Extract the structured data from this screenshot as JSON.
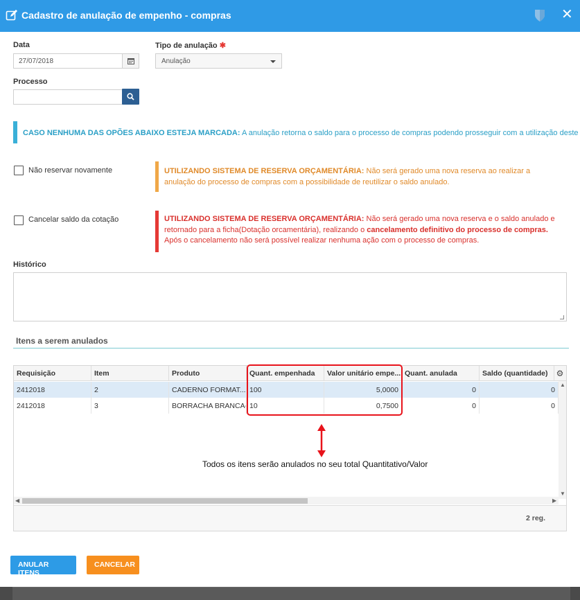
{
  "header": {
    "title": "Cadastro de anulação de empenho - compras",
    "close_glyph": "✕",
    "icons": [
      "edit-icon",
      "shield-icon",
      "close-icon"
    ]
  },
  "form": {
    "date_label": "Data",
    "date_value": "27/07/2018",
    "type_label": "Tipo de anulação",
    "required_mark": "✱",
    "type_value": "Anulação",
    "process_label": "Processo",
    "process_value": ""
  },
  "info": {
    "bold": "CASO NENHUMA DAS OPÕES ABAIXO ESTEJA MARCADA:",
    "text": " A anulação retorna o saldo para o processo de compras podendo prosseguir com a utilização deste saldo."
  },
  "options": [
    {
      "label": "Não reservar novamente",
      "checked": false,
      "warn_bold": "UTILIZANDO SISTEMA DE RESERVA ORÇAMENTÁRIA:",
      "warn_text": " Não será gerado uma nova reserva ao realizar a anulação do processo de compras com a possibilidade de reutilizar o saldo anulado.",
      "color": "#e8962e"
    },
    {
      "label": "Cancelar saldo da cotação",
      "checked": false,
      "warn_bold": "UTILIZANDO SISTEMA DE RESERVA ORÇAMENTÁRIA:",
      "warn_text_a": " Não será gerado uma nova reserva e o saldo anulado e retornado para a ficha(Dotação orcamentária), realizando o ",
      "warn_bold_b": "cancelamento definitivo do processo de compras.",
      "warn_text_c": " Após o cancelamento não será possível realizar nenhuma ação com o processo de compras.",
      "color": "#e53935"
    }
  ],
  "history": {
    "label": "Histórico",
    "value": ""
  },
  "items": {
    "title": "Itens a serem anulados",
    "columns": [
      "Requisição",
      "Item",
      "Produto",
      "Quant. empenhada",
      "Valor unitário empe...",
      "Quant. anulada",
      "Saldo (quantidade)"
    ],
    "rows": [
      [
        "2412018",
        "2",
        "CADERNO FORMAT...",
        "100",
        "5,0000",
        "0",
        "0"
      ],
      [
        "2412018",
        "3",
        "BORRACHA BRANCA-",
        "10",
        "0,7500",
        "0",
        "0"
      ]
    ],
    "count": "2 reg.",
    "gear_glyph": "⚙"
  },
  "annotation": {
    "note": "Todos os itens serão anulados no seu total Quantitativo/Valor",
    "color": "#e8131b"
  },
  "buttons": {
    "confirm": "ANULAR ITENS",
    "cancel": "CANCELAR"
  },
  "colors": {
    "header": "#2f9ae6",
    "primary": "#2d9be6",
    "cancel": "#f78f1e",
    "info": "#2a9fc6"
  }
}
